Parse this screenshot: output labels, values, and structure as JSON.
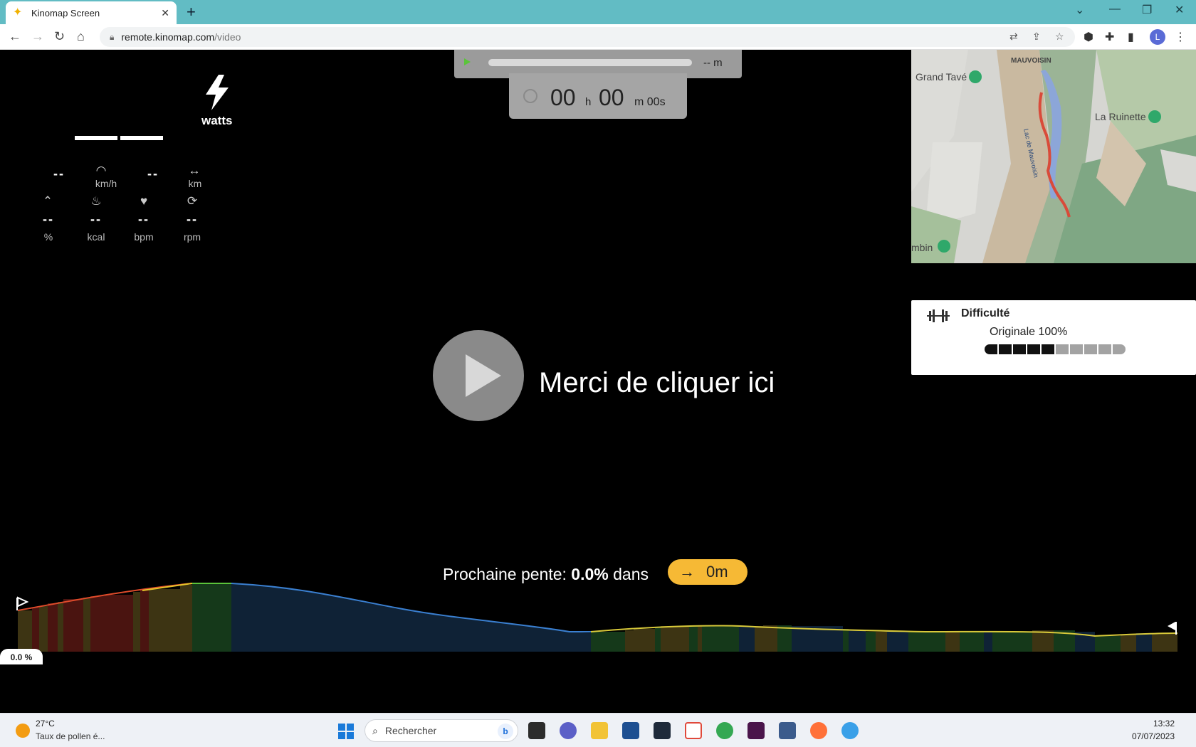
{
  "browser": {
    "tab_title": "Kinomap Screen",
    "url_host": "remote.kinomap.com",
    "url_path": "/video",
    "profile_initial": "L"
  },
  "metrics": {
    "power_value": "——",
    "power_unit": "watts",
    "speed": {
      "value": "--",
      "unit": "km/h",
      "icon": "speedometer-icon"
    },
    "distance": {
      "value": "--",
      "unit": "km",
      "icon": "distance-arrows-icon"
    },
    "slope": {
      "value": "--",
      "unit": "%",
      "icon": "slope-icon"
    },
    "calories": {
      "value": "--",
      "unit": "kcal",
      "icon": "flame-icon"
    },
    "heart_rate": {
      "value": "--",
      "unit": "bpm",
      "icon": "heart-icon"
    },
    "cadence": {
      "value": "--",
      "unit": "rpm",
      "icon": "refresh-icon"
    }
  },
  "progress": {
    "distance_label": "-- m"
  },
  "timer": {
    "hours": "00",
    "hours_unit": "h",
    "minutes": "00",
    "minutes_unit": "m",
    "seconds": "00s"
  },
  "map": {
    "labels": [
      "MAUVOISIN",
      "Grand Tavé",
      "La Ruinette",
      "Lac de Mauvoisin",
      "mbin"
    ]
  },
  "difficulty": {
    "title": "Difficulté",
    "level_label": "Originale 100%",
    "filled_segments": 5,
    "total_segments": 10
  },
  "center": {
    "cta": "Merci de cliquer ici"
  },
  "next_slope": {
    "prefix": "Prochaine pente:",
    "value": "0.0%",
    "suffix": "dans",
    "distance": "0m"
  },
  "profile": {
    "current_slope": "0.0 %"
  },
  "taskbar": {
    "weather_temp": "27°C",
    "weather_desc": "Taux de pollen é...",
    "search_placeholder": "Rechercher",
    "time": "13:32",
    "date": "07/07/2023"
  },
  "colors": {
    "accent_yellow": "#f6b935",
    "tab_bar": "#62bcc4",
    "profile_blue": "#0f2236",
    "profile_green": "#15391a",
    "profile_red": "#4a1410",
    "profile_olive": "#3d3413"
  }
}
